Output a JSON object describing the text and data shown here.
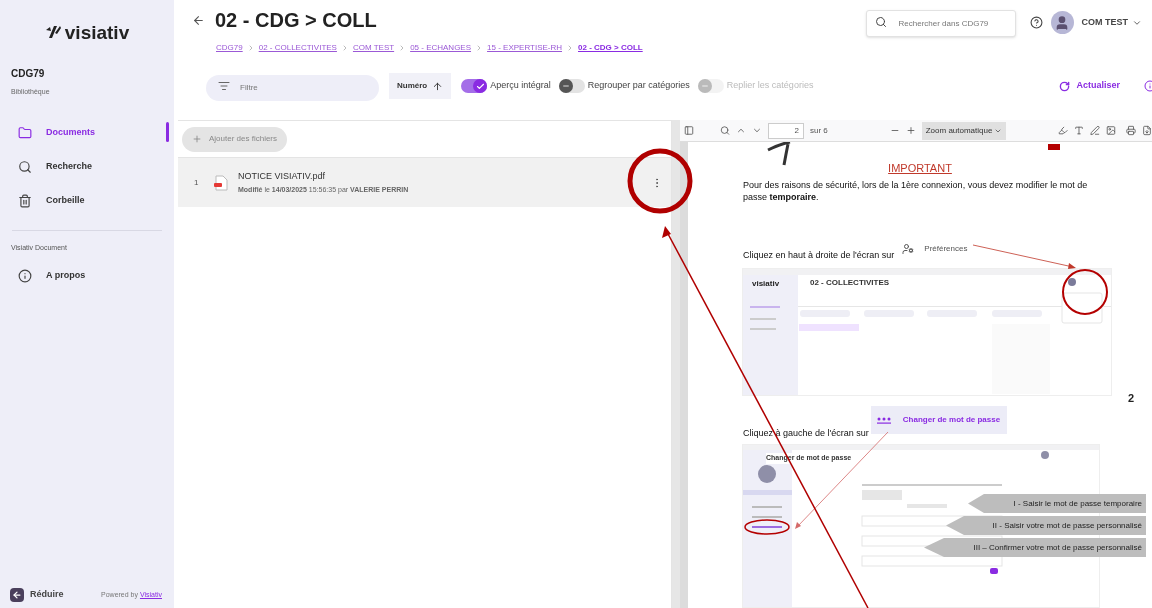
{
  "sidebar": {
    "logo": "visiativ",
    "library": {
      "name": "CDG79",
      "subtitle": "Bibliothèque"
    },
    "nav": [
      {
        "label": "Documents",
        "selected": true
      },
      {
        "label": "Recherche",
        "selected": false
      },
      {
        "label": "Corbeille",
        "selected": false
      }
    ],
    "section_label": "Visiativ Document",
    "secondary_nav": [
      {
        "label": "A propos",
        "selected": false
      }
    ],
    "collapse": "Réduire",
    "powered_by": {
      "text": "Powered by",
      "link": "Visiativ"
    }
  },
  "header": {
    "title": "02 - CDG > COLL",
    "breadcrumb": [
      {
        "label": "CDG79",
        "current": false
      },
      {
        "label": "02 - COLLECTIVITES",
        "current": false
      },
      {
        "label": "COM TEST",
        "current": false
      },
      {
        "label": "05 - ECHANGES",
        "current": false
      },
      {
        "label": "15 - EXPERTISE-RH",
        "current": false
      },
      {
        "label": "02 - CDG > COLL",
        "current": true
      }
    ],
    "search_placeholder": "Rechercher dans CDG79",
    "user": "COM TEST"
  },
  "toolbar": {
    "filter_placeholder": "Filtre",
    "sort": "Numéro",
    "toggles": [
      {
        "label": "Aperçu intégral",
        "on": true,
        "disabled": false
      },
      {
        "label": "Regrouper par catégories",
        "on": false,
        "disabled": false
      },
      {
        "label": "Replier les catégories",
        "on": false,
        "disabled": true
      }
    ],
    "refresh": "Actualiser"
  },
  "files": {
    "add_button": "Ajouter des fichiers",
    "rows": [
      {
        "index": "1",
        "name": "NOTICE VISIATIV.pdf",
        "meta": "**Modifié** le **14/03/2025** 15:56:35 par **VALERIE PERRIN**",
        "selected": true
      }
    ]
  },
  "viewer": {
    "page": "2",
    "page_total": "sur 6",
    "zoom": "Zoom automatique",
    "document": {
      "heading": "IMPORTANT",
      "intro": "Pour des raisons de sécurité, lors de  la 1ère  connexion, vous devez modifier le mot de passe **temporaire**.",
      "step1": {
        "text": "Cliquez en haut à droite de l'écran sur",
        "target": "Préférences"
      },
      "screenshot1": {
        "logo": "visiativ",
        "title": "02 - COLLECTIVITES"
      },
      "page_number": "2",
      "step2": {
        "text": "Cliquez à gauche de l'écran sur",
        "target": "Changer de mot de passe"
      },
      "screenshot2": {
        "title": "Changer de mot de passe",
        "callouts": [
          "I - Saisir le mot de passe temporaire",
          "II - Saisir votre mot de passe personnalisé",
          "III – Confirmer votre mot de passe personnalisé"
        ]
      }
    }
  }
}
